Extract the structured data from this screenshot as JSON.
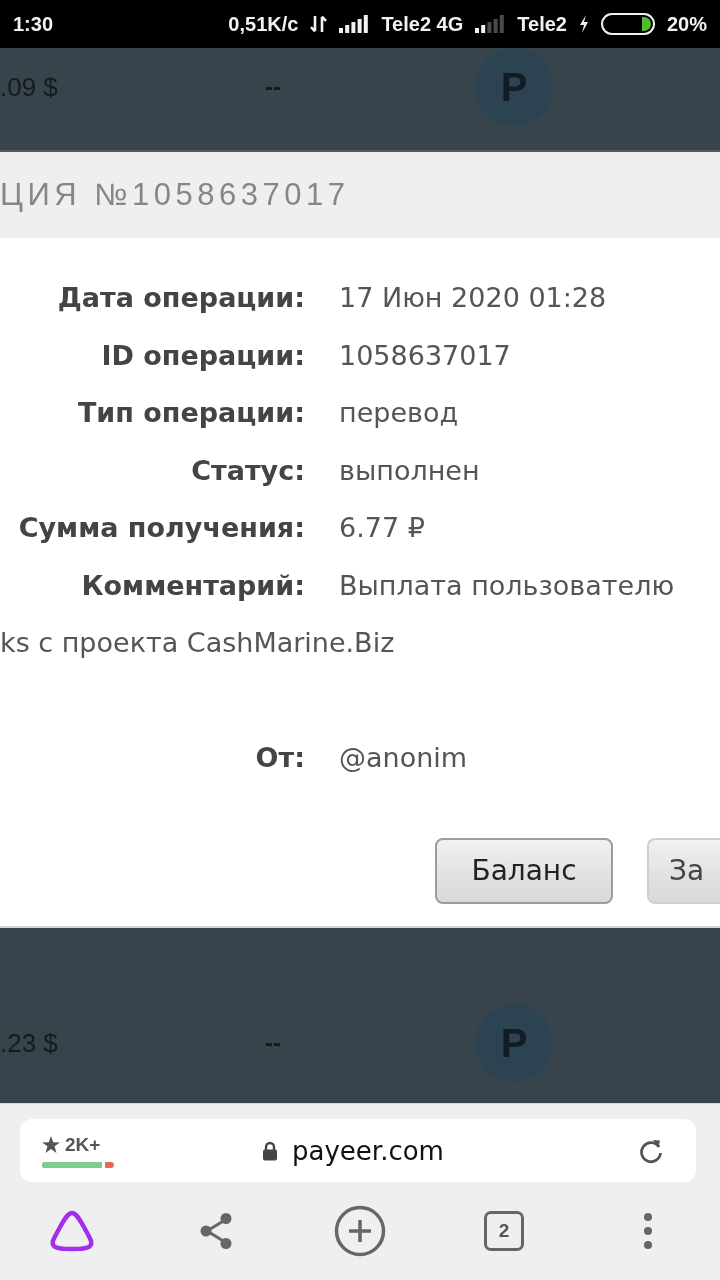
{
  "status_bar": {
    "time": "1:30",
    "network_speed": "0,51K/с",
    "sim_1": "Tele2 4G",
    "sim_2": "Tele2",
    "battery": "20%"
  },
  "background_rows": [
    {
      "amount": ".09 $",
      "column_2": "--",
      "logo_letter": "P"
    },
    {
      "amount": ".23 $",
      "column_2": "--",
      "logo_letter": "P"
    }
  ],
  "dialog": {
    "title": "ЦИЯ №1058637017",
    "rows": [
      {
        "label": "Дата операции:",
        "value": "17 Июн 2020 01:28"
      },
      {
        "label": "ID операции:",
        "value": "1058637017"
      },
      {
        "label": "Тип операции:",
        "value": "перевод"
      },
      {
        "label": "Статус:",
        "value": "выполнен"
      },
      {
        "label": "Сумма получения:",
        "value": "6.77 ₽"
      },
      {
        "label": "Комментарий:",
        "value": "Выплата пользователю",
        "continuation": "ks с проекта CashMarine.Biz"
      }
    ],
    "sender": {
      "label": "От:",
      "value": "@anonim"
    },
    "buttons": [
      "Баланс",
      "За"
    ]
  },
  "browser": {
    "rating": {
      "count": "2K+",
      "level": 0.88
    },
    "url": "payeer.com",
    "tab_count": "2"
  }
}
